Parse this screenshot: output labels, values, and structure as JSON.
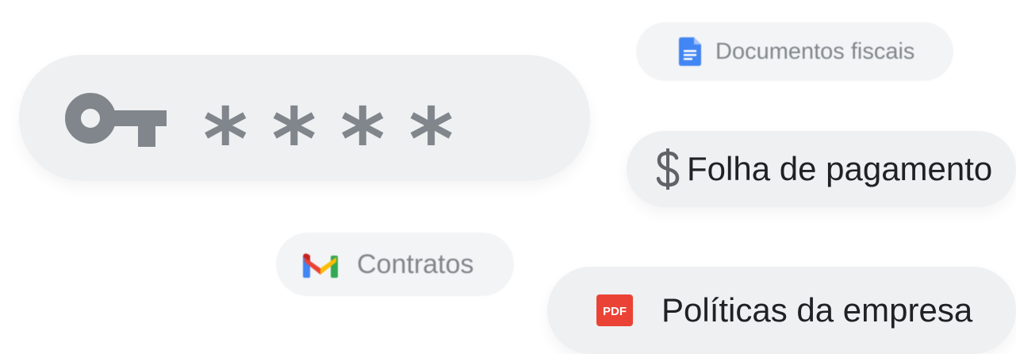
{
  "password_field": {
    "masked_value": "****",
    "icon": "key-icon"
  },
  "tags": [
    {
      "label": "Documentos fiscais",
      "icon": "google-docs-icon"
    },
    {
      "label": "Folha de pagamento",
      "icon": "dollar-icon"
    },
    {
      "label": "Contratos",
      "icon": "gmail-icon"
    },
    {
      "label": "Políticas da empresa",
      "icon": "pdf-icon",
      "icon_text": "PDF"
    }
  ],
  "colors": {
    "pill_background": "#eef0f2",
    "icon_gray": "#80868b",
    "text_dark": "#202124",
    "docs_blue": "#4285f4",
    "pdf_red": "#ea4335"
  }
}
